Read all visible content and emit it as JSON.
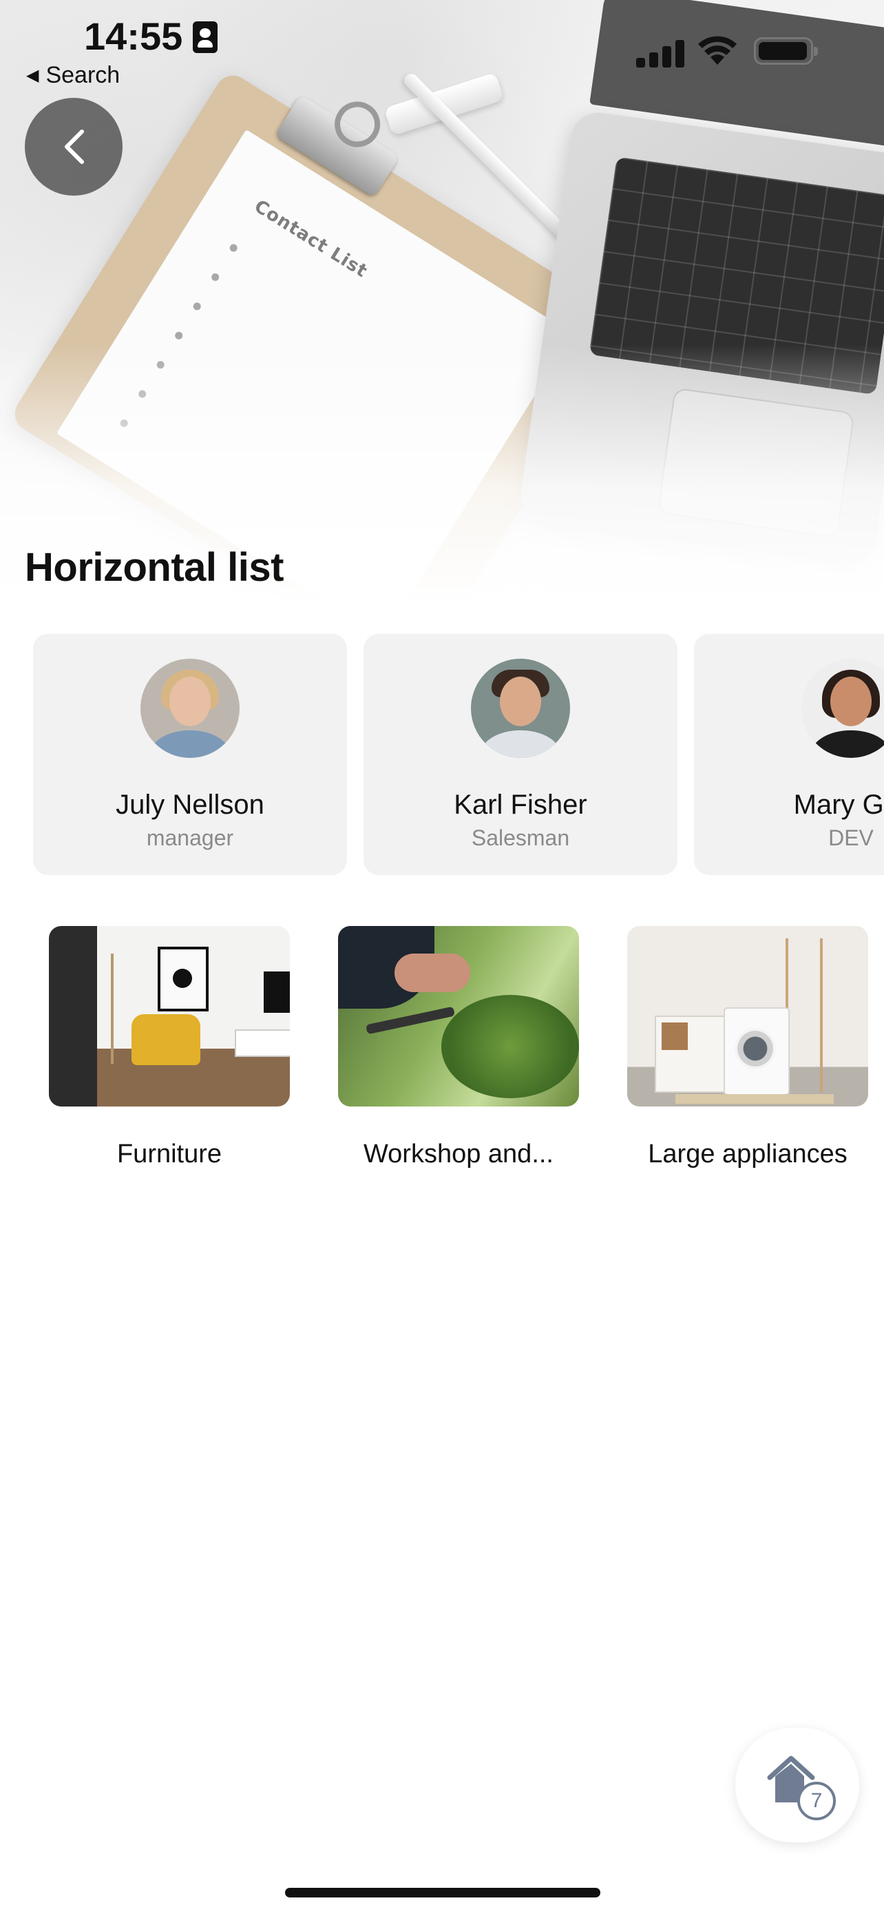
{
  "status_bar": {
    "time": "14:55",
    "back_app_label": "Search",
    "icons": [
      "id-card-icon",
      "cellular-signal-icon",
      "wifi-icon",
      "battery-icon"
    ]
  },
  "hero": {
    "title": "Horizontal list",
    "image_text": "Contact List",
    "back_icon": "chevron-left-icon"
  },
  "contacts": [
    {
      "name": "July Nellson",
      "role": "manager"
    },
    {
      "name": "Karl Fisher",
      "role": "Salesman"
    },
    {
      "name": "Mary Gor",
      "role": "DEV"
    }
  ],
  "categories": [
    {
      "label": "Furniture"
    },
    {
      "label": "Workshop and..."
    },
    {
      "label": "Large appliances"
    }
  ],
  "fab": {
    "icon": "home-icon",
    "badge": "7"
  },
  "colors": {
    "card_bg": "#f2f2f2",
    "role_text": "#8a8a8a",
    "fab_icon": "#6f7c92"
  }
}
